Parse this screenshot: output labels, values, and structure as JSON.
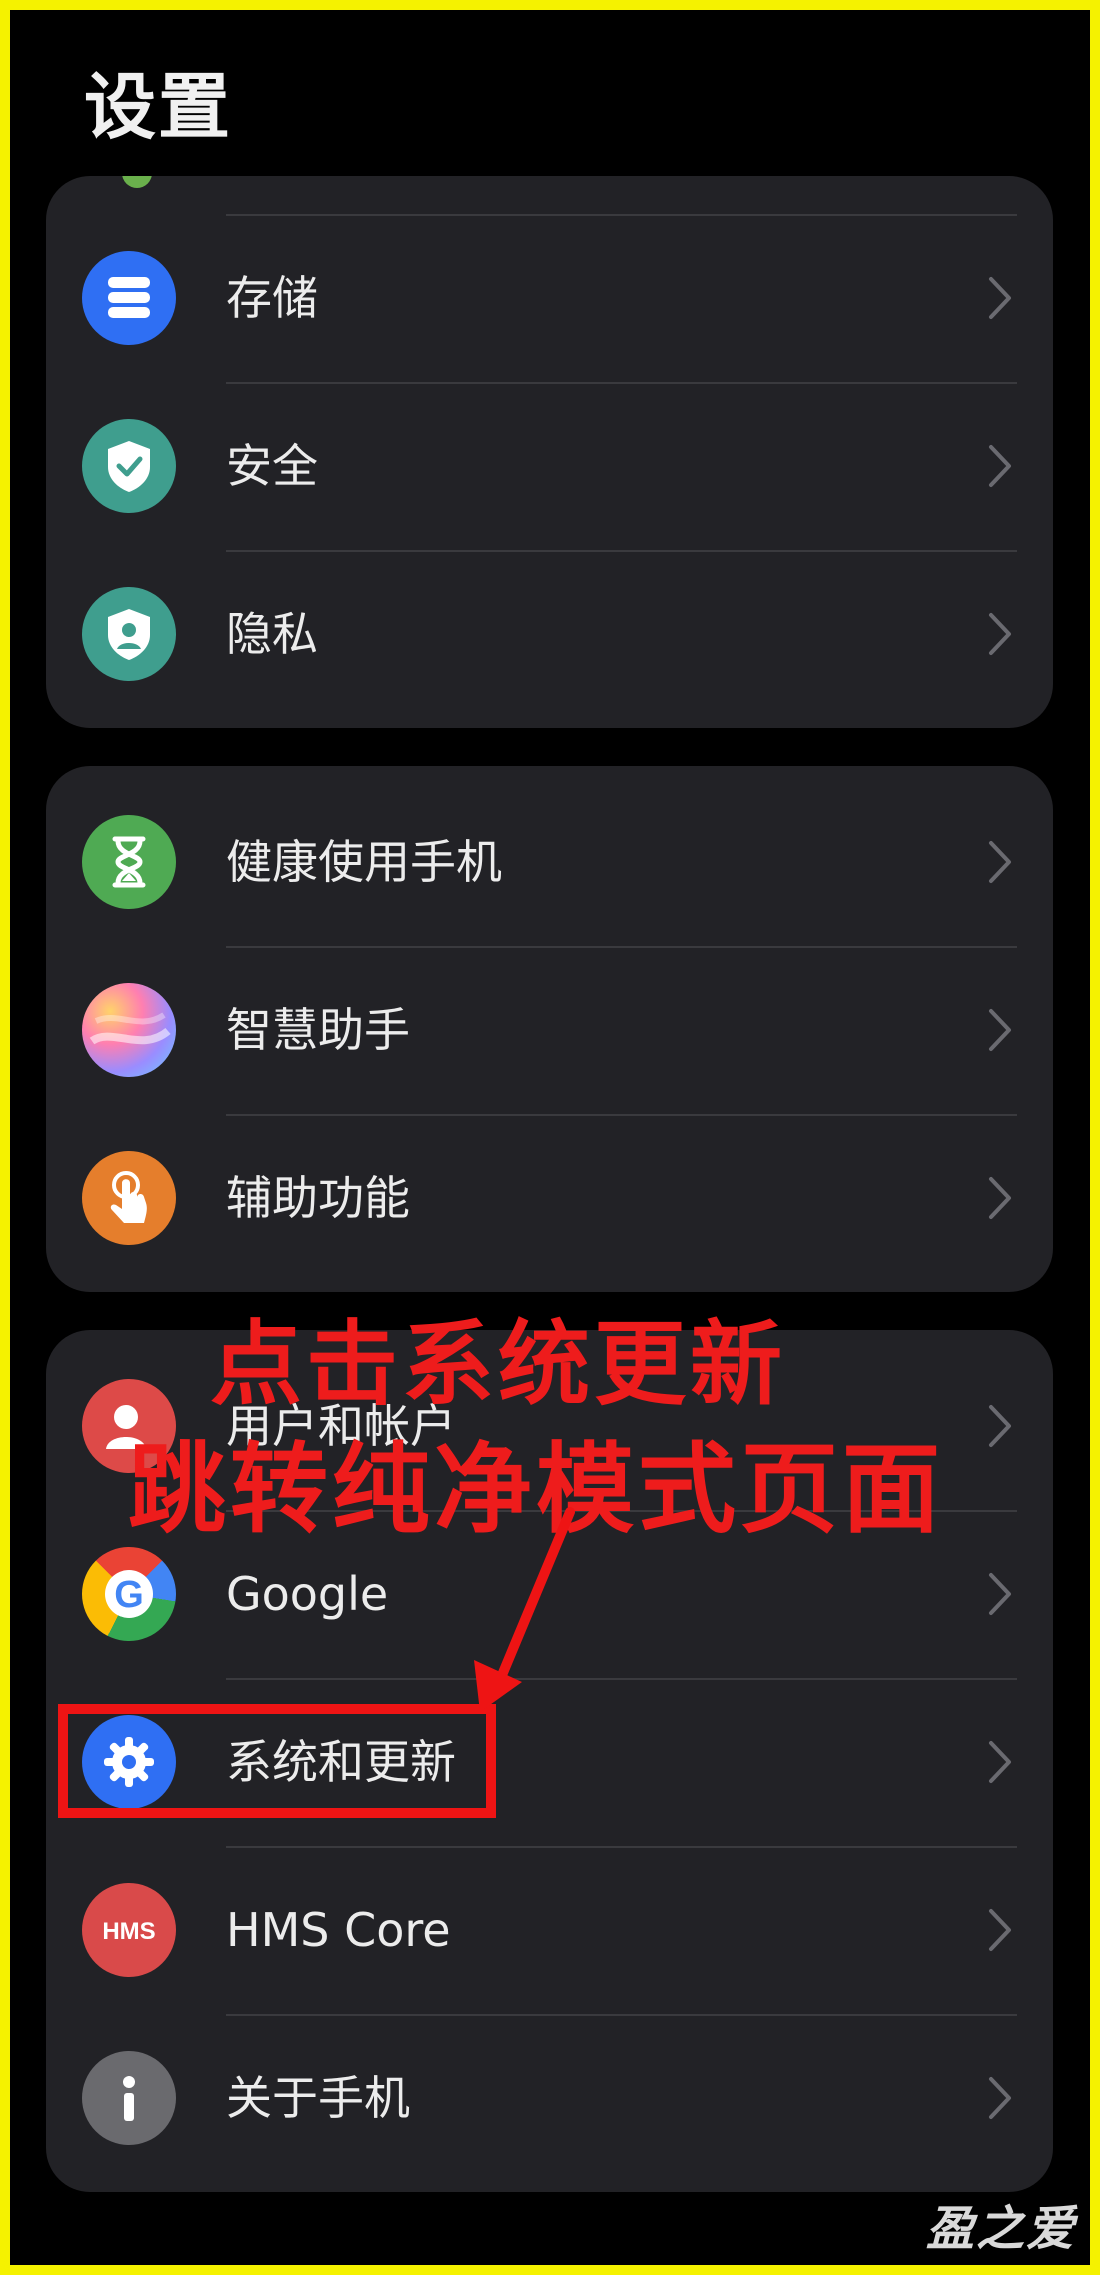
{
  "header": {
    "title": "设置"
  },
  "group1": {
    "items": [
      {
        "label": "存储",
        "icon": "storage-icon",
        "icon_color": "#2f6ff3"
      },
      {
        "label": "安全",
        "icon": "shield-check-icon",
        "icon_color": "#3f9e8e"
      },
      {
        "label": "隐私",
        "icon": "privacy-shield-icon",
        "icon_color": "#3f9e8e"
      }
    ]
  },
  "group2": {
    "items": [
      {
        "label": "健康使用手机",
        "icon": "hourglass-icon",
        "icon_color": "#4faa53"
      },
      {
        "label": "智慧助手",
        "icon": "gradient-orb-icon",
        "icon_color": "#b9a6ff"
      },
      {
        "label": "辅助功能",
        "icon": "tap-hand-icon",
        "icon_color": "#e57e2c"
      }
    ]
  },
  "group3": {
    "items": [
      {
        "label": "用户和帐户",
        "icon": "user-icon",
        "icon_color": "#dd4a48"
      },
      {
        "label": "Google",
        "icon": "google-icon",
        "icon_color": "#ffffff"
      },
      {
        "label": "系统和更新",
        "icon": "gear-icon",
        "icon_color": "#2f6ff3"
      },
      {
        "label": "HMS Core",
        "icon": "hms-icon",
        "icon_color": "#d94a4a"
      },
      {
        "label": "关于手机",
        "icon": "info-icon",
        "icon_color": "#6a6a6e"
      }
    ]
  },
  "annotation": {
    "line1": "点击系统更新",
    "line2": "跳转纯净模式页面",
    "color": "#ee1c1c"
  },
  "watermark": {
    "text": "盈之爱"
  },
  "colors": {
    "border": "#f5f200",
    "card": "#222226",
    "background": "#000000"
  }
}
